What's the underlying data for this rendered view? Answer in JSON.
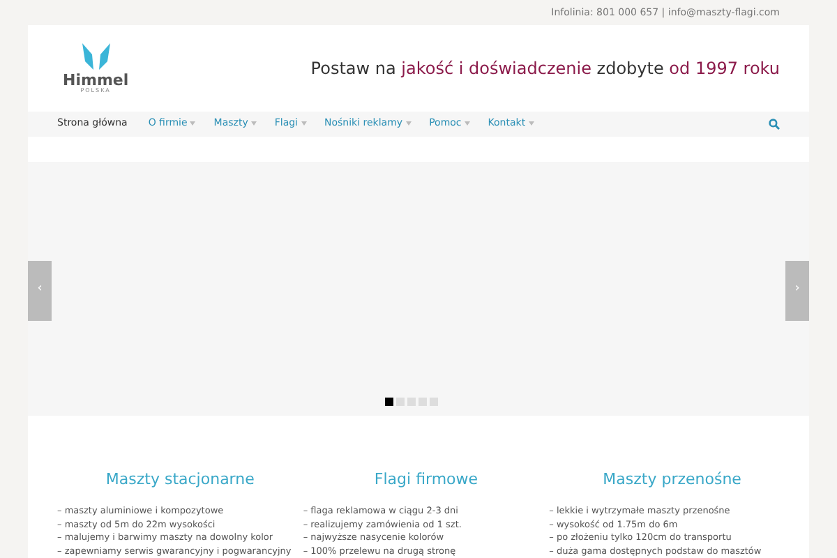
{
  "top_bar": {
    "contact": "Infolinia: 801 000 657 | info@maszty-flagi.com"
  },
  "logo": {
    "name": "Himmel",
    "subtitle": "POLSKA"
  },
  "tagline": [
    {
      "text": "Postaw na ",
      "highlight": false
    },
    {
      "text": "jakość i doświadczenie",
      "highlight": true
    },
    {
      "text": " zdobyte ",
      "highlight": false
    },
    {
      "text": "od 1997 roku",
      "highlight": true
    }
  ],
  "nav": [
    {
      "label": "Strona główna",
      "selected": true,
      "has_dropdown": false
    },
    {
      "label": "O firmie",
      "selected": false,
      "has_dropdown": true
    },
    {
      "label": "Maszty",
      "selected": false,
      "has_dropdown": true
    },
    {
      "label": "Flagi",
      "selected": false,
      "has_dropdown": true
    },
    {
      "label": "Nośniki reklamy",
      "selected": false,
      "has_dropdown": true
    },
    {
      "label": "Pomoc",
      "selected": false,
      "has_dropdown": true
    },
    {
      "label": "Kontakt",
      "selected": false,
      "has_dropdown": true
    }
  ],
  "slider": {
    "prev": "‹",
    "next": "›",
    "dots": [
      {
        "selected": true
      },
      {
        "selected": false
      },
      {
        "selected": false
      },
      {
        "selected": false
      },
      {
        "selected": false
      }
    ]
  },
  "features": [
    {
      "title": "Maszty stacjonarne",
      "items": [
        "– maszty aluminiowe i kompozytowe",
        "– maszty od 5m do 22m wysokości",
        "– malujemy i barwimy maszty na dowolny kolor",
        "– zapewniamy serwis gwarancyjny i pogwarancyjny"
      ]
    },
    {
      "title": "Flagi firmowe",
      "items": [
        "– flaga reklamowa w ciągu 2-3 dni",
        "– realizujemy zamówienia od 1 szt.",
        "– najwyższe nasycenie kolorów",
        "– 100% przelewu na drugą stronę"
      ]
    },
    {
      "title": "Maszty przenośne",
      "items": [
        "– lekkie i wytrzymałe maszty przenośne",
        "– wysokość od 1.75m do 6m",
        "– po złożeniu tylko 120cm do transportu",
        "– duża gama dostępnych podstaw do masztów"
      ]
    }
  ]
}
